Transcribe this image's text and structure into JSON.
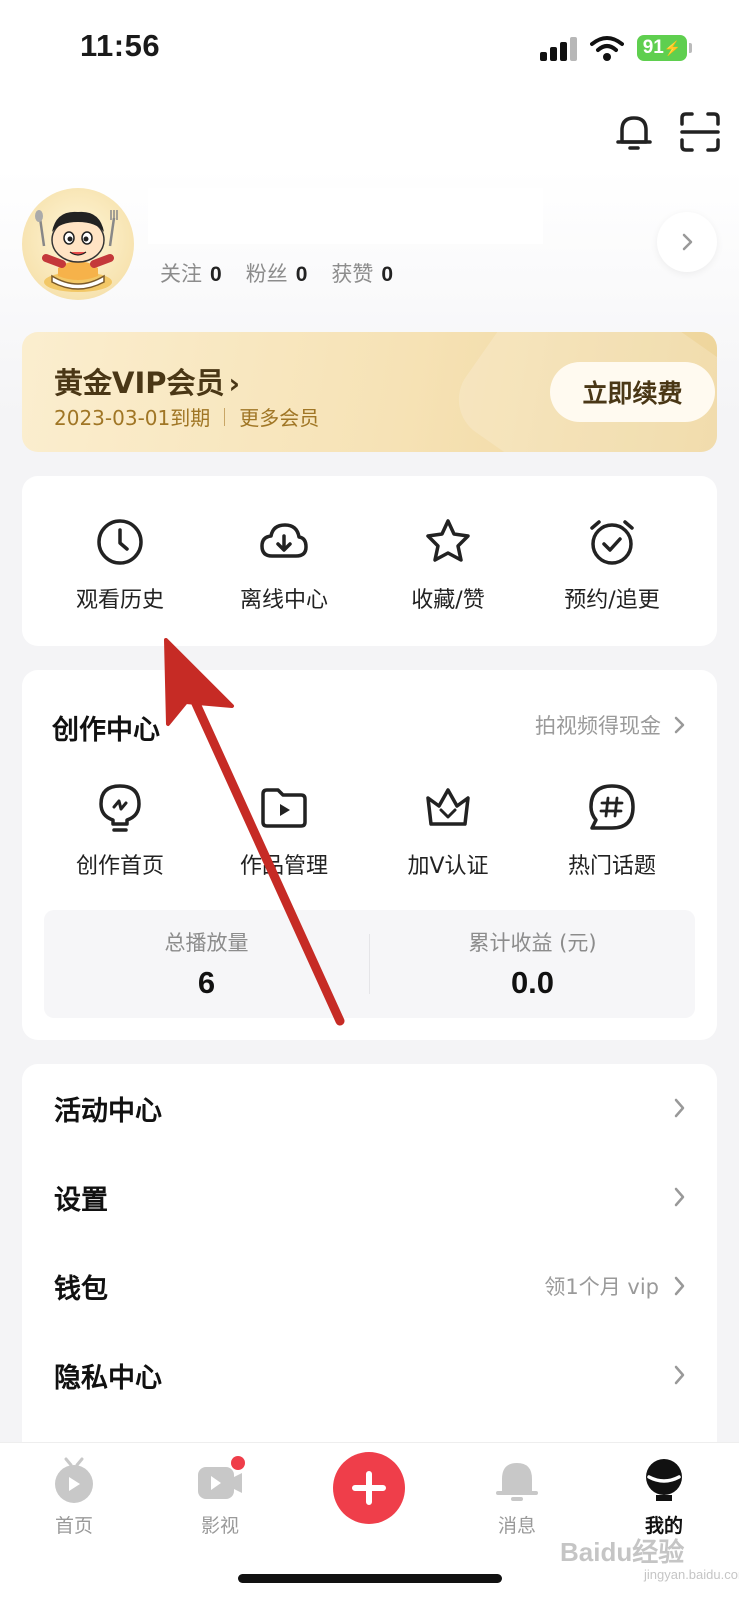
{
  "status_bar": {
    "time": "11:56",
    "battery": "91"
  },
  "profile": {
    "stats": [
      {
        "label": "关注",
        "value": "0"
      },
      {
        "label": "粉丝",
        "value": "0"
      },
      {
        "label": "获赞",
        "value": "0"
      }
    ]
  },
  "vip": {
    "title": "黄金VIP会员",
    "expiry": "2023-03-01到期",
    "more": "更多会员",
    "renew_label": "立即续费"
  },
  "quick_actions": [
    {
      "label": "观看历史",
      "icon": "clock-icon"
    },
    {
      "label": "离线中心",
      "icon": "cloud-download-icon"
    },
    {
      "label": "收藏/赞",
      "icon": "star-icon"
    },
    {
      "label": "预约/追更",
      "icon": "alarm-clock-icon"
    }
  ],
  "creator": {
    "title": "创作中心",
    "more": "拍视频得现金",
    "items": [
      {
        "label": "创作首页",
        "icon": "bulb-icon"
      },
      {
        "label": "作品管理",
        "icon": "video-folder-icon"
      },
      {
        "label": "加V认证",
        "icon": "crown-icon"
      },
      {
        "label": "热门话题",
        "icon": "hashtag-icon"
      }
    ],
    "stats": [
      {
        "label": "总播放量",
        "value": "6"
      },
      {
        "label": "累计收益 (元)",
        "value": "0.0"
      }
    ]
  },
  "menu": [
    {
      "label": "活动中心",
      "right": ""
    },
    {
      "label": "设置",
      "right": ""
    },
    {
      "label": "钱包",
      "right": "领1个月 vip"
    },
    {
      "label": "隐私中心",
      "right": ""
    }
  ],
  "tabbar": [
    {
      "label": "首页",
      "icon": "home-tv-icon"
    },
    {
      "label": "影视",
      "icon": "video-icon"
    },
    {
      "label": "",
      "icon": "plus-icon"
    },
    {
      "label": "消息",
      "icon": "message-bell-icon"
    },
    {
      "label": "我的",
      "icon": "profile-icon"
    }
  ],
  "watermark": {
    "main": "Baidu经验",
    "sub": "jingyan.baidu.com"
  },
  "colors": {
    "accent": "#ef3e4a",
    "vip_gold": "#4a3716",
    "annotation": "#c62b25"
  }
}
